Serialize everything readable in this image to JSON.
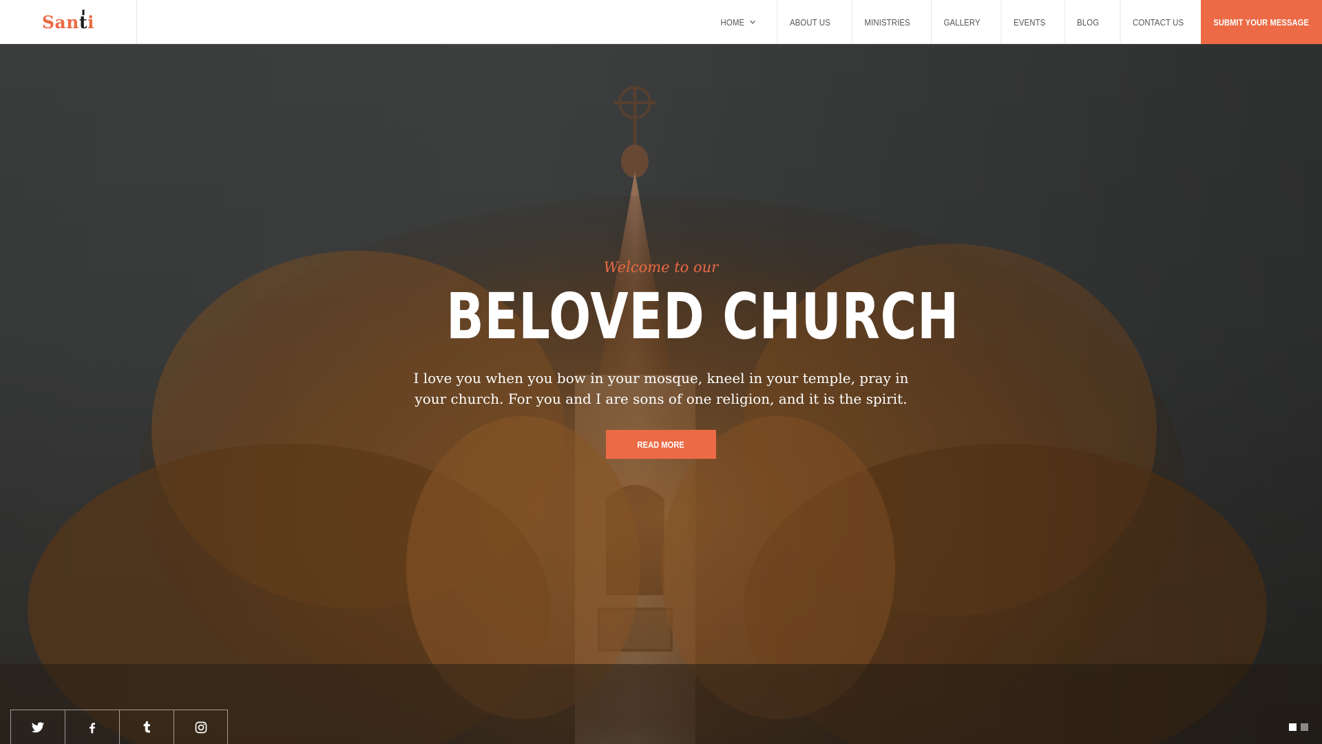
{
  "brand": {
    "logo_main": "San",
    "logo_cross": "t",
    "logo_end": "i",
    "accent": "#ec6a45"
  },
  "nav": {
    "items": [
      {
        "label": "HOME",
        "has_dropdown": true
      },
      {
        "label": "ABOUT US"
      },
      {
        "label": "MINISTRIES"
      },
      {
        "label": "GALLERY"
      },
      {
        "label": "EVENTS"
      },
      {
        "label": "BLOG"
      },
      {
        "label": "CONTACT US"
      }
    ],
    "cta_label": "SUBMIT YOUR MESSAGE"
  },
  "hero": {
    "kicker": "Welcome to our",
    "title": "BELOVED CHURCH",
    "text": "I love you when you bow in your mosque, kneel in your temple, pray in your church. For you and I are sons of one religion, and it is the spirit.",
    "button_label": "READ MORE"
  },
  "social": [
    {
      "icon": "twitter-icon"
    },
    {
      "icon": "facebook-icon"
    },
    {
      "icon": "tumblr-icon"
    },
    {
      "icon": "instagram-icon"
    }
  ],
  "slider": {
    "count": 2,
    "active_index": 0
  }
}
